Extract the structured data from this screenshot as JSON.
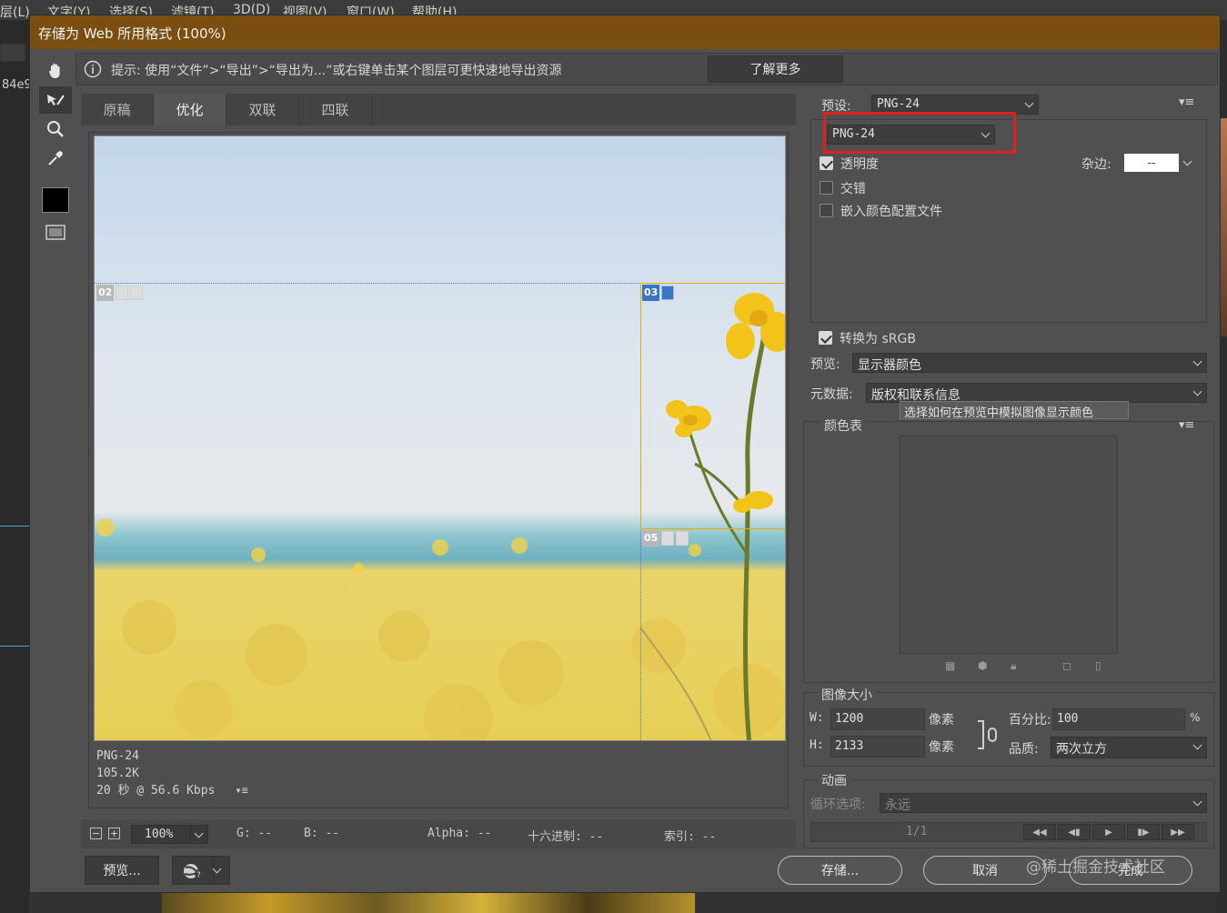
{
  "app": {
    "menu": [
      "层(L)",
      "文字(Y)",
      "选择(S)",
      "滤镜(T)",
      "3D(D)",
      "视图(V)",
      "窗口(W)",
      "帮助(H)"
    ],
    "side_label": "84e9"
  },
  "dialog": {
    "title": "存储为 Web 所用格式 (100%)",
    "hint": "提示: 使用“文件”>“导出”>“导出为...”或右键单击某个图层可更快速地导出资源",
    "learn_more": "了解更多",
    "tabs": [
      "原稿",
      "优化",
      "双联",
      "四联"
    ],
    "active_tab": "优化"
  },
  "preview": {
    "slices": [
      {
        "label": "02"
      },
      {
        "label": "03"
      },
      {
        "label": "05"
      }
    ],
    "info": {
      "format": "PNG-24",
      "size": "105.2K",
      "time": "20 秒 @ 56.6 Kbps",
      "menu_icon": "▾≡"
    }
  },
  "status": {
    "zoom": "100%",
    "g": "G: --",
    "b": "B: --",
    "alpha": "Alpha: --",
    "hex": "十六进制: --",
    "index": "索引: --"
  },
  "buttons": {
    "preview": "预览...",
    "save": "存储...",
    "cancel": "取消",
    "done": "完成"
  },
  "settings": {
    "preset_label": "预设:",
    "preset_value": "PNG-24",
    "format_value": "PNG-24",
    "transparency": {
      "label": "透明度",
      "checked": true
    },
    "matte_label": "杂边:",
    "matte_value": "--",
    "interlaced": {
      "label": "交错",
      "checked": false
    },
    "embed_profile": {
      "label": "嵌入颜色配置文件",
      "checked": false
    },
    "convert_srgb": {
      "label": "转换为 sRGB",
      "checked": true
    },
    "preview_label": "预览:",
    "preview_value": "显示器颜色",
    "metadata_label": "元数据:",
    "metadata_value": "版权和联系信息",
    "tooltip": "选择如何在预览中模拟图像显示颜色",
    "color_table_label": "颜色表"
  },
  "image_size": {
    "title": "图像大小",
    "w_label": "W:",
    "w_value": "1200",
    "h_label": "H:",
    "h_value": "2133",
    "unit": "像素",
    "percent_label": "百分比:",
    "percent_value": "100",
    "percent_unit": "%",
    "quality_label": "品质:",
    "quality_value": "两次立方"
  },
  "animation": {
    "title": "动画",
    "loop_label": "循环选项:",
    "loop_value": "永远",
    "frame": "1/1"
  },
  "watermark": "@稀土掘金技术社区",
  "colors": {
    "titlebar": "#7a4d10",
    "highlight": "#e02020",
    "slice_selected": "#3b76c4"
  }
}
